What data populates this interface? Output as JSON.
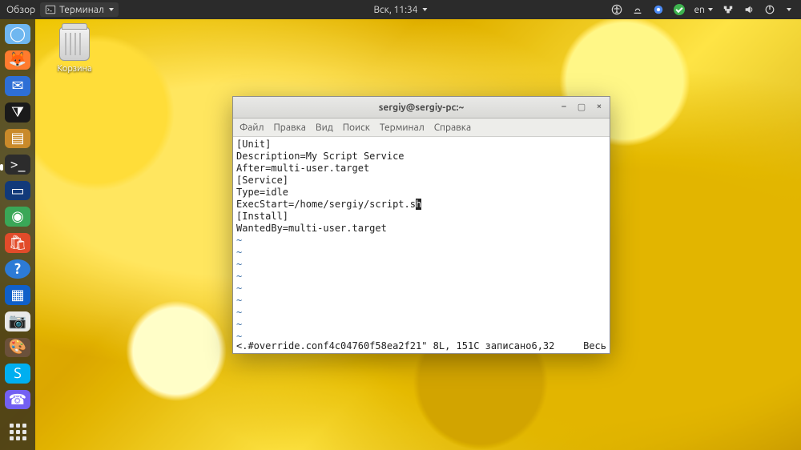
{
  "topbar": {
    "overview": "Обзор",
    "active_app": "Терминал",
    "clock": "Вск, 11:34",
    "lang": "en"
  },
  "desktop": {
    "trash_label": "Корзина"
  },
  "dock": {
    "items": [
      {
        "name": "chromium",
        "color": "#6fb7f0",
        "glyph": "◯"
      },
      {
        "name": "firefox",
        "color": "#ff7b2e",
        "glyph": "🦊"
      },
      {
        "name": "thunderbird",
        "color": "#2e6fd6",
        "glyph": "✉"
      },
      {
        "name": "vscode",
        "color": "#1a1a1a",
        "glyph": "⧩"
      },
      {
        "name": "notes",
        "color": "#c98a2a",
        "glyph": "▤"
      },
      {
        "name": "terminal",
        "color": "#2c2c2c",
        "glyph": ">_",
        "active": true
      },
      {
        "name": "writer",
        "color": "#123a7a",
        "glyph": "▭"
      },
      {
        "name": "mate",
        "color": "#3aa757",
        "glyph": "◉"
      },
      {
        "name": "software",
        "color": "#e24b2a",
        "glyph": "🛍"
      },
      {
        "name": "help",
        "color": "#2d7bd6",
        "glyph": "?"
      },
      {
        "name": "virtualbox",
        "color": "#1060c9",
        "glyph": "▦"
      },
      {
        "name": "camera",
        "color": "#e8e8e8",
        "glyph": "📷"
      },
      {
        "name": "gimp",
        "color": "#6b513b",
        "glyph": "🎨"
      },
      {
        "name": "skype",
        "color": "#00aff0",
        "glyph": "S"
      },
      {
        "name": "viber",
        "color": "#7360f2",
        "glyph": "☎"
      }
    ]
  },
  "window": {
    "title": "sergiy@sergiy-pc:~",
    "menu": {
      "file": "Файл",
      "edit": "Правка",
      "view": "Вид",
      "search": "Поиск",
      "terminal": "Терминал",
      "help": "Справка"
    },
    "editor_lines": [
      "[Unit]",
      "Description=My Script Service",
      "After=multi-user.target",
      "[Service]",
      "Type=idle",
      "ExecStart=/home/sergiy/script.s",
      "[Install]",
      "WantedBy=multi-user.target"
    ],
    "cursor_line_index": 5,
    "cursor_tail": "h",
    "status": {
      "left": "<.#override.conf4c04760f58ea2f21\" 8L, 151C записано",
      "pos": "6,32",
      "right": "Весь"
    }
  }
}
